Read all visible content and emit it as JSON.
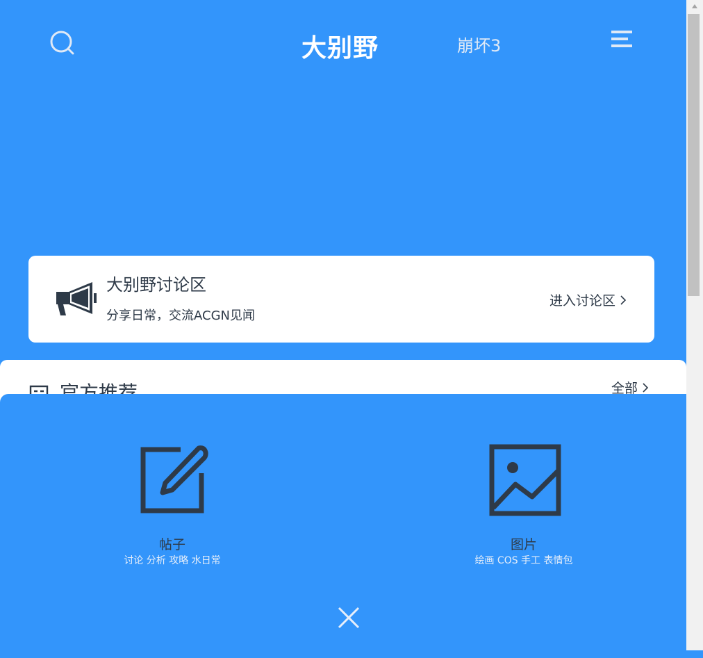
{
  "header": {
    "logo": "大别野",
    "game": "崩坏3"
  },
  "discussion": {
    "title": "大别野讨论区",
    "subtitle": "分享日常，交流ACGN见闻",
    "enter_label": "进入讨论区"
  },
  "recommend": {
    "title": "官方推荐",
    "all_label": "全部"
  },
  "publish": {
    "options": [
      {
        "label": "帖子",
        "sub": "讨论 分析 攻略 水日常"
      },
      {
        "label": "图片",
        "sub": "绘画 COS 手工 表情包"
      }
    ]
  },
  "colors": {
    "brand_blue": "#3395fb",
    "dark_text": "#2e3a48",
    "card_white": "#ffffff"
  },
  "icons": [
    "search-icon",
    "menu-icon",
    "megaphone-icon",
    "recommend-icon",
    "edit-icon",
    "image-icon",
    "close-icon",
    "chevron-right-icon"
  ]
}
